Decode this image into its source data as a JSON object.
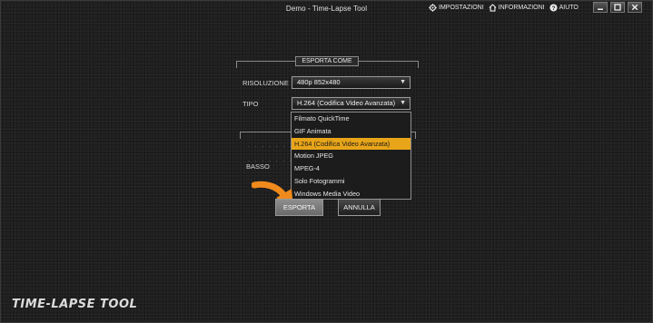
{
  "window": {
    "title": "Demo - Time-Lapse Tool",
    "nav": [
      {
        "label": "IMPOSTAZIONI",
        "icon": "gear-icon"
      },
      {
        "label": "INFORMAZIONI",
        "icon": "home-icon"
      },
      {
        "label": "AIUTO",
        "icon": "help-icon"
      }
    ],
    "controls": [
      "minimize-icon",
      "maximize-icon",
      "close-icon"
    ]
  },
  "export_section": {
    "title": "ESPORTA COME",
    "resolution_label": "RISOLUZIONE",
    "resolution_value": "480p 852x480",
    "type_label": "TIPO",
    "type_value": "H.264 (Codifica Video Avanzata)",
    "quality_low_label": "BASSO",
    "dropdown_options": [
      "Filmato QuickTime",
      "GIF Animata",
      "H.264 (Codifica Video Avanzata)",
      "Motion JPEG",
      "MPEG-4",
      "Solo Fotogrammi",
      "Windows Media Video"
    ],
    "selected_option": "H.264 (Codifica Video Avanzata)",
    "caret": "▼"
  },
  "buttons": {
    "export": "ESPORTA",
    "cancel": "ANNULLA"
  },
  "logo_text": "TIME-LAPSE TOOL",
  "colors": {
    "accent": "#e8a519",
    "arrow": "#f08a1c"
  }
}
